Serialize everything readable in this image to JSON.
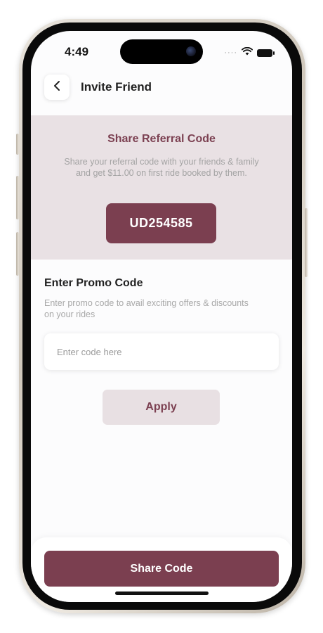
{
  "status_bar": {
    "time": "4:49",
    "signal_dots": "····"
  },
  "header": {
    "title": "Invite Friend",
    "back_icon": "chevron-left-icon"
  },
  "referral": {
    "title": "Share Referral Code",
    "description": "Share your referral code with your friends & family and get $11.00 on first ride booked by them.",
    "code": "UD254585"
  },
  "promo": {
    "title": "Enter Promo Code",
    "description": "Enter promo code to avail exciting offers & discounts on your rides",
    "input_value": "",
    "input_placeholder": "Enter code here",
    "apply_label": "Apply"
  },
  "footer": {
    "share_label": "Share Code"
  },
  "colors": {
    "primary": "#7b3f50",
    "primary_light": "#e9e1e4",
    "text_dark": "#222222",
    "text_muted": "#a3a3a3"
  }
}
